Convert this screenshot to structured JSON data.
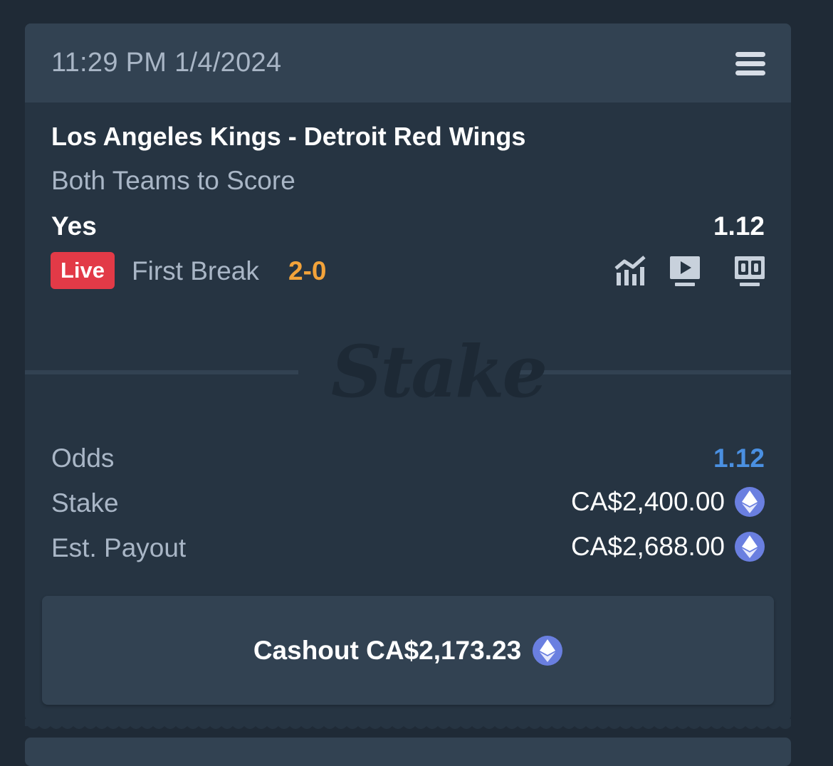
{
  "header": {
    "timestamp": "11:29 PM 1/4/2024",
    "menu_icon": "list-menu-icon"
  },
  "bet": {
    "match": "Los Angeles Kings - Detroit Red Wings",
    "market": "Both Teams to Score",
    "selection": "Yes",
    "selection_odds": "1.12",
    "live_label": "Live",
    "period": "First Break",
    "score": "2-0",
    "icons": [
      "stats-chart-icon",
      "live-stream-icon",
      "scoreboard-icon"
    ]
  },
  "watermark": "Stake",
  "summary": {
    "odds_label": "Odds",
    "odds_value": "1.12",
    "stake_label": "Stake",
    "stake_value": "CA$2,400.00",
    "payout_label": "Est. Payout",
    "payout_value": "CA$2,688.00",
    "currency_icon": "ethereum-icon"
  },
  "cashout": {
    "label": "Cashout CA$2,173.23"
  },
  "colors": {
    "background": "#1f2a36",
    "card": "#263442",
    "header": "#324252",
    "live": "#e23a47",
    "score": "#f3a33a",
    "odds": "#4a90e2",
    "eth": "#6a7fe0"
  }
}
